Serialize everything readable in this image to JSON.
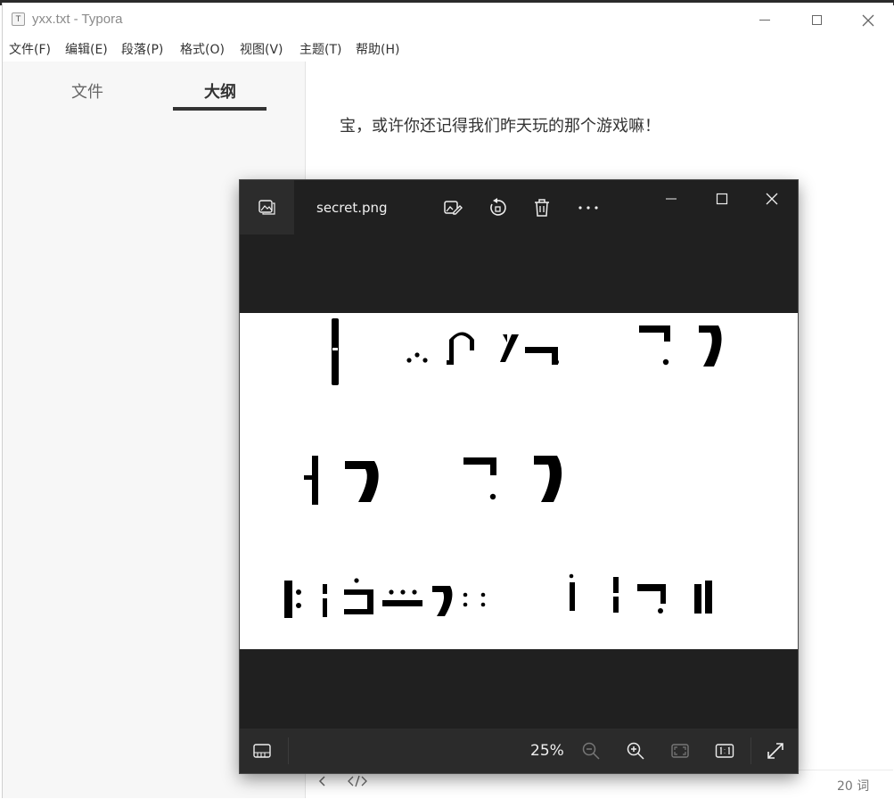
{
  "window": {
    "title": "yxx.txt - Typora",
    "app_icon_letter": "T"
  },
  "menu": [
    {
      "label": "文件(F)"
    },
    {
      "label": "编辑(E)"
    },
    {
      "label": "段落(P)"
    },
    {
      "label": "格式(O)"
    },
    {
      "label": "视图(V)"
    },
    {
      "label": "主题(T)"
    },
    {
      "label": "帮助(H)"
    }
  ],
  "sidebar": {
    "tab_files": "文件",
    "tab_outline": "大纲",
    "active_tab": "大纲"
  },
  "editor": {
    "content": "宝，或许你还记得我们昨天玩的那个游戏嘛！"
  },
  "statusbar": {
    "word_count": "20 词",
    "back_icon": "chevron-left-icon",
    "source_icon": "code-icon"
  },
  "photos": {
    "filename": "secret.png",
    "zoom": "25%",
    "toolbar_icons": [
      "edit-image-icon",
      "rotate-icon",
      "delete-icon",
      "more-icon"
    ],
    "bottom_icons": [
      "filmstrip-icon",
      "zoom-out-icon",
      "zoom-in-icon",
      "fit-screen-icon",
      "actual-size-icon",
      "fullscreen-icon"
    ],
    "image_description": "pigpen-cipher-glyphs"
  }
}
